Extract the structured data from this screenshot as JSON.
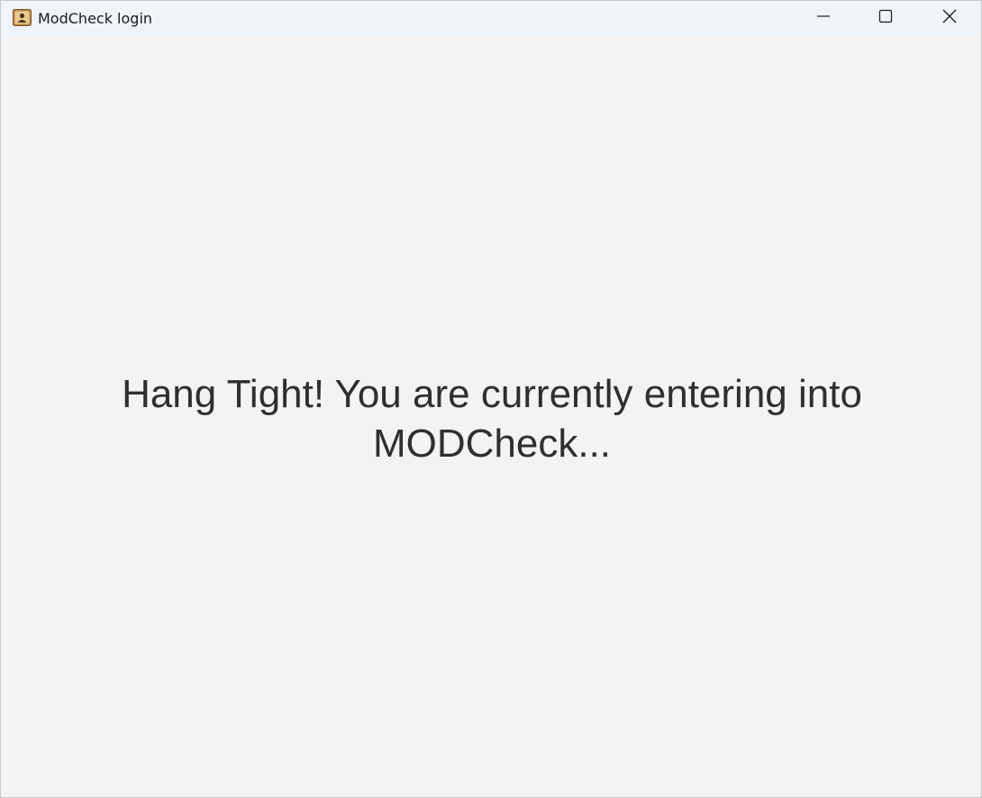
{
  "window": {
    "title": "ModCheck login",
    "app_icon": "contact-card-icon",
    "controls": {
      "minimize_icon": "minimize-icon",
      "maximize_icon": "maximize-icon",
      "close_icon": "close-icon"
    }
  },
  "main": {
    "message": "Hang Tight! You are currently entering into MODCheck..."
  },
  "colors": {
    "titlebar_bg": "#eff4f9",
    "content_bg": "#f3f3f3",
    "text": "#2f2f2f"
  }
}
